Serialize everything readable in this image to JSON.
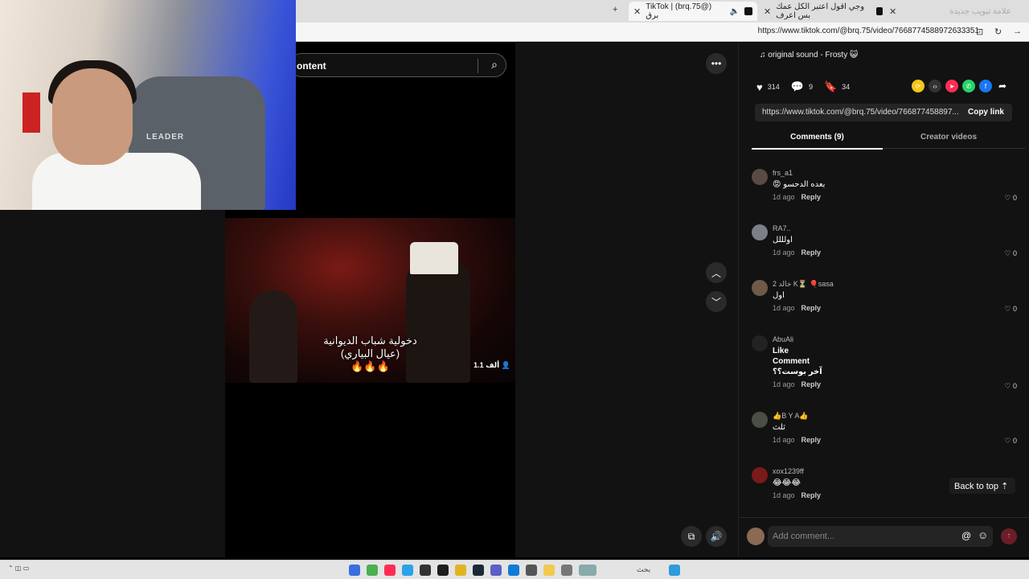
{
  "browser": {
    "tabs": [
      {
        "label": "TikTok | (brq.75@) برق"
      },
      {
        "label": "وجي اقول اعتبر الكل عمك بس اعرف"
      },
      {
        "label": "علامة تبويب جديدة"
      }
    ],
    "new_tab": "+",
    "url": "https://www.tiktok.com/@brq.75/video/7668774588972633351"
  },
  "search": {
    "text": "ontent"
  },
  "video": {
    "caption_line1": "دخولية شباب الديوانية",
    "caption_line2": "(عيال البياري)",
    "caption_line3": "🔥🔥🔥",
    "views": "1.1 ألف"
  },
  "webcam": {
    "brand": "LEADER"
  },
  "panel": {
    "sound": "original sound - Frosty 😺",
    "likes": "314",
    "comments_count": "9",
    "saves": "34",
    "link": "https://www.tiktok.com/@brq.75/video/766877458897...",
    "copy_link": "Copy link",
    "tab_comments": "Comments (9)",
    "tab_creator": "Creator videos",
    "reply_label": "Reply",
    "back_to_top": "Back to top",
    "add_comment_placeholder": "Add comment..."
  },
  "comments": [
    {
      "user": "frs_a1",
      "text": "😡 بعده الدحسو",
      "time": "1d ago",
      "likes": "0"
    },
    {
      "user": "RA7..",
      "text": "اولللل",
      "time": "1d ago",
      "likes": "0"
    },
    {
      "user": "2 خالد K⏳ 🎈sasa",
      "text": "اول",
      "time": "1d ago",
      "likes": "0"
    },
    {
      "user": "AbuAli",
      "text": "Like\nComment\nآخر بوست؟؟",
      "time": "1d ago",
      "likes": "0"
    },
    {
      "user": "👍B Y A👍",
      "text": "ثلث",
      "time": "1d ago",
      "likes": "0"
    },
    {
      "user": "xox1239ff",
      "text": "😂😂😂",
      "time": "1d ago",
      "likes": "0"
    }
  ],
  "taskbar": {
    "search": "بحث"
  },
  "colors": {
    "accent": "#fe2c55",
    "background": "#121212"
  }
}
